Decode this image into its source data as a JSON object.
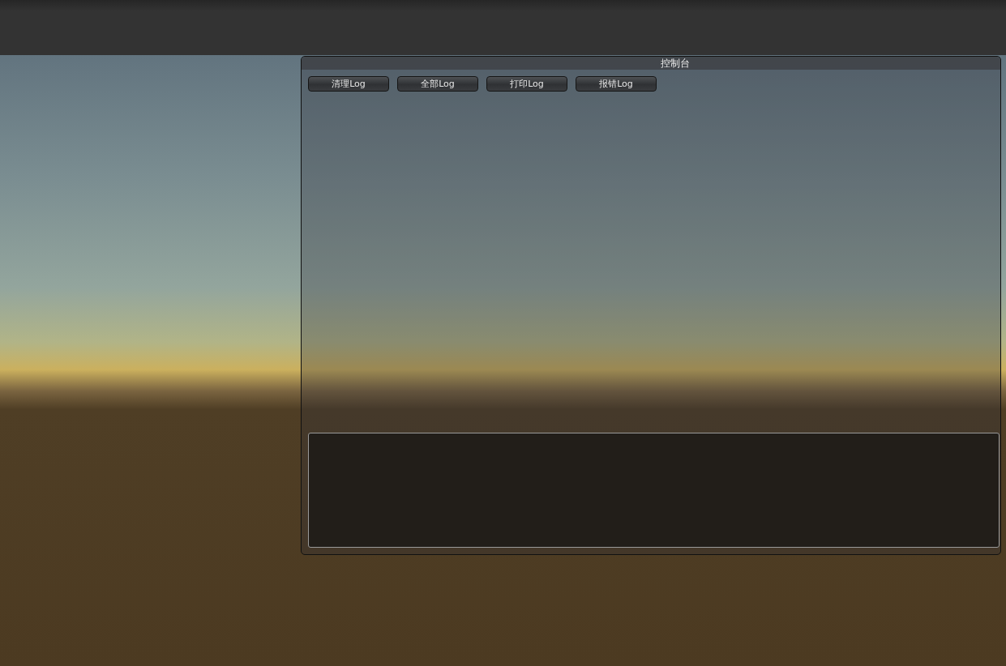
{
  "console_window": {
    "title": "控制台",
    "buttons": [
      {
        "label": "清理Log"
      },
      {
        "label": "全部Log"
      },
      {
        "label": "打印Log"
      },
      {
        "label": "报错Log"
      }
    ]
  }
}
